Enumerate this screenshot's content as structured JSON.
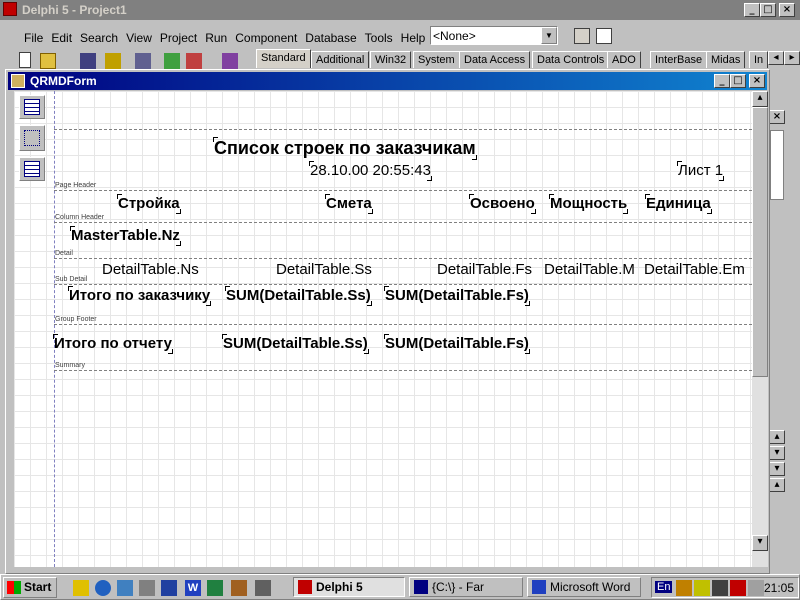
{
  "ide": {
    "title": "Delphi 5 - Project1",
    "menu": [
      "File",
      "Edit",
      "Search",
      "View",
      "Project",
      "Run",
      "Component",
      "Database",
      "Tools",
      "Help"
    ],
    "combo_value": "<None>",
    "palette_tabs": [
      "Standard",
      "Additional",
      "Win32",
      "System",
      "Data Access",
      "Data Controls",
      "ADO",
      "InterBase",
      "Midas",
      "In"
    ]
  },
  "form": {
    "title": "QRMDForm"
  },
  "report": {
    "bands": {
      "page_header": "Page Header",
      "column_header": "Column Header",
      "detail": "Detail",
      "sub_detail": "Sub Detail",
      "group_footer": "Group Footer",
      "summary": "Summary"
    },
    "title": "Список строек по заказчикам",
    "datetime": "28.10.00 20:55:43",
    "page": "Лист 1",
    "columns": [
      "Стройка",
      "Смета",
      "Освоено",
      "Мощность",
      "Единица"
    ],
    "master_field": "MasterTable.Nz",
    "detail_fields": [
      "DetailTable.Ns",
      "DetailTable.Ss",
      "DetailTable.Fs",
      "DetailTable.M",
      "DetailTable.Em"
    ],
    "group_label": "Итого по заказчику",
    "group_sum_ss": "SUM(DetailTable.Ss)",
    "group_sum_fs": "SUM(DetailTable.Fs)",
    "summary_label": "Итого по отчету",
    "summary_sum_ss": "SUM(DetailTable.Ss)",
    "summary_sum_fs": "SUM(DetailTable.Fs)"
  },
  "taskbar": {
    "start": "Start",
    "tasks": [
      "Delphi 5",
      "{C:\\} - Far",
      "Microsoft Word"
    ],
    "lang": "En",
    "clock": "21:05"
  },
  "colors": {
    "title_active": "#000080",
    "desktop": "#c0c0c0"
  }
}
